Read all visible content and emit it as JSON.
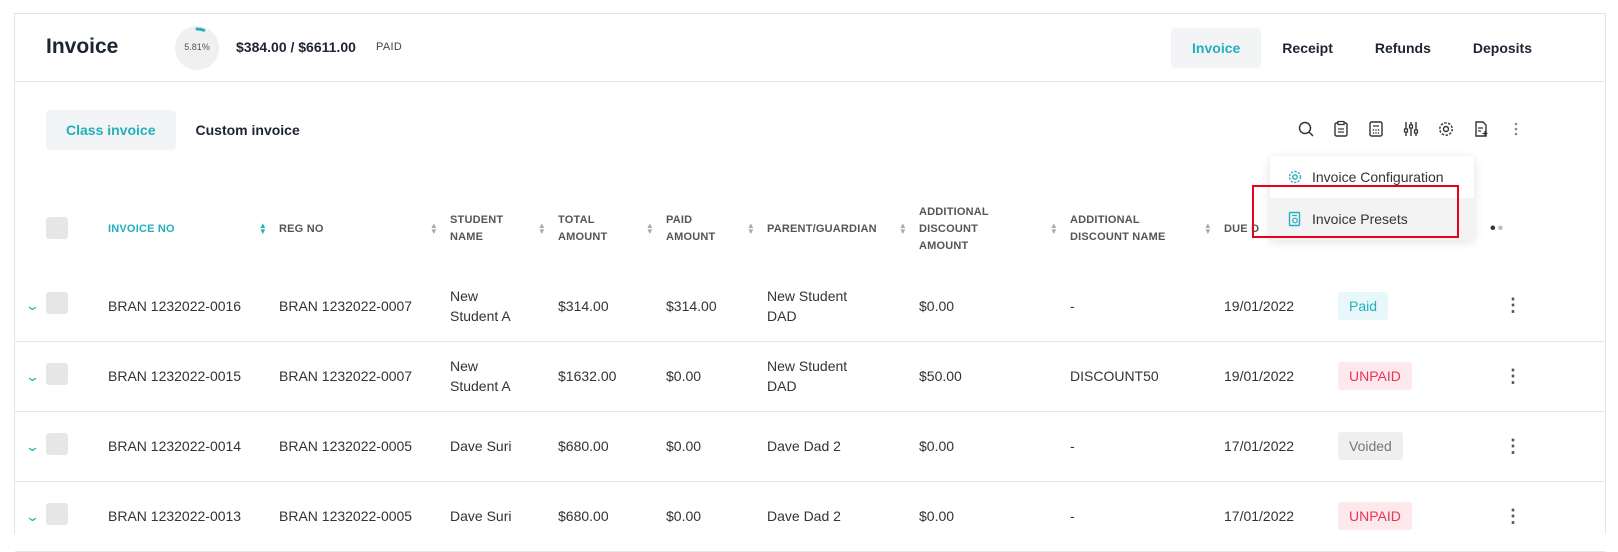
{
  "header": {
    "title": "Invoice",
    "progress_label": "5.81%",
    "progress_fraction": 0.0581,
    "amount": "$384.00 / $6611.00",
    "status": "PAID"
  },
  "tabs": [
    "Invoice",
    "Receipt",
    "Refunds",
    "Deposits"
  ],
  "subtabs": [
    "Class invoice",
    "Custom invoice"
  ],
  "toolbar_icons": [
    "search-icon",
    "clipboard-icon",
    "calculator-icon",
    "sliders-icon",
    "gear-icon",
    "document-add-icon",
    "more-vertical-icon"
  ],
  "menu": {
    "items": [
      "Invoice Configuration",
      "Invoice Presets"
    ]
  },
  "table": {
    "headers": {
      "invoice_no": "INVOICE NO",
      "reg_no": "REG NO",
      "student_name_1": "STUDENT",
      "student_name_2": "NAME",
      "total_amount_1": "TOTAL",
      "total_amount_2": "AMOUNT",
      "paid_amount_1": "PAID",
      "paid_amount_2": "AMOUNT",
      "parent": "PARENT/GUARDIAN",
      "add_disc_amt_1": "ADDITIONAL",
      "add_disc_amt_2": "DISCOUNT",
      "add_disc_amt_3": "AMOUNT",
      "add_disc_name_1": "ADDITIONAL",
      "add_disc_name_2": "DISCOUNT NAME",
      "due_date": "DUE D"
    },
    "rows": [
      {
        "invoice_no": "BRAN 1232022-0016",
        "reg_no": "BRAN 1232022-0007",
        "student_1": "New",
        "student_2": "Student A",
        "total": "$314.00",
        "paid": "$314.00",
        "parent_1": "New Student",
        "parent_2": "DAD",
        "disc_amt": "$0.00",
        "disc_name": "-",
        "due": "19/01/2022",
        "status": "Paid"
      },
      {
        "invoice_no": "BRAN 1232022-0015",
        "reg_no": "BRAN 1232022-0007",
        "student_1": "New",
        "student_2": "Student A",
        "total": "$1632.00",
        "paid": "$0.00",
        "parent_1": "New Student",
        "parent_2": "DAD",
        "disc_amt": "$50.00",
        "disc_name": "DISCOUNT50",
        "due": "19/01/2022",
        "status": "UNPAID"
      },
      {
        "invoice_no": "BRAN 1232022-0014",
        "reg_no": "BRAN 1232022-0005",
        "student_1": "Dave Suri",
        "student_2": "",
        "total": "$680.00",
        "paid": "$0.00",
        "parent_1": "Dave Dad 2",
        "parent_2": "",
        "disc_amt": "$0.00",
        "disc_name": "-",
        "due": "17/01/2022",
        "status": "Voided"
      },
      {
        "invoice_no": "BRAN 1232022-0013",
        "reg_no": "BRAN 1232022-0005",
        "student_1": "Dave Suri",
        "student_2": "",
        "total": "$680.00",
        "paid": "$0.00",
        "parent_1": "Dave Dad 2",
        "parent_2": "",
        "disc_amt": "$0.00",
        "disc_name": "-",
        "due": "17/01/2022",
        "status": "UNPAID"
      }
    ]
  },
  "colors": {
    "accent": "#22b0bd",
    "unpaid": "#e8345a",
    "highlight_box": "#e8001c"
  }
}
